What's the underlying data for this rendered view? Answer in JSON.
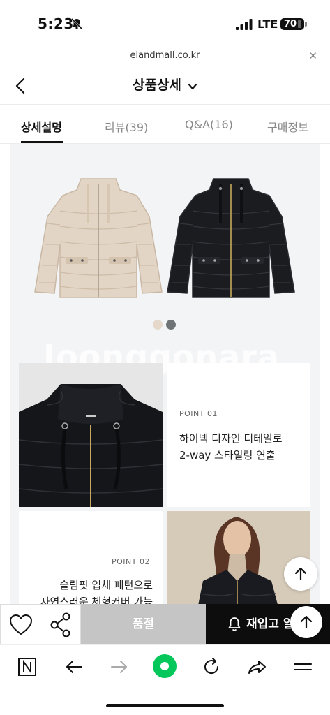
{
  "status_bar": {
    "time": "5:23",
    "network": "LTE",
    "battery": "70"
  },
  "url_bar": {
    "domain": "elandmall.co.kr"
  },
  "header": {
    "title": "상품상세"
  },
  "tabs": [
    {
      "label": "상세설명"
    },
    {
      "label": "리뷰(39)"
    },
    {
      "label": "Q&A(16)"
    },
    {
      "label": "구매정보"
    }
  ],
  "content": {
    "watermark": "Joonggonara",
    "color_swatches": [
      "#e6d9cc",
      "#6e7475"
    ],
    "point1": {
      "label": "POINT 01",
      "line1": "하이넥 디자인 디테일로",
      "line2": "2-way 스타일링 연출"
    },
    "point2": {
      "label": "POINT 02",
      "line1": "슬림핏 입체 패턴으로",
      "line2": "자연스러운 체형커버 가능"
    }
  },
  "action_bar": {
    "soldout_label": "품절",
    "restock_label": "재입고 알림"
  },
  "colors": {
    "black_button": "#0d0d0d",
    "soldout_gray": "#c5c5c5",
    "naver_green": "#03c75a"
  }
}
